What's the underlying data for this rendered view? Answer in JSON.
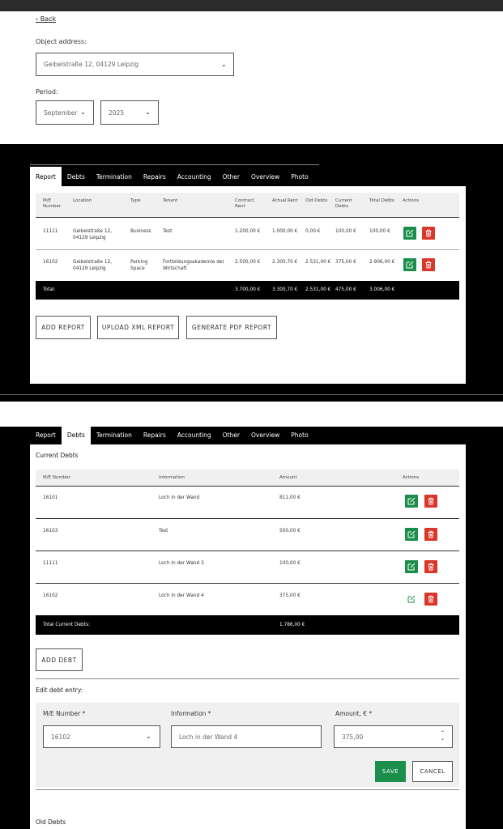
{
  "back": "Back",
  "object_address": {
    "label": "Object address:",
    "value": "Geibelstraße 12, 04129 Leipzig"
  },
  "period": {
    "label": "Period:",
    "month": "September",
    "year": "2025"
  },
  "tabs": [
    "Report",
    "Debts",
    "Termination",
    "Repairs",
    "Accounting",
    "Other",
    "Overview",
    "Photo"
  ],
  "report": {
    "headers": [
      "M/E Number",
      "Location",
      "Type",
      "Tenant",
      "Contract Rent",
      "Actual Rent",
      "Old Debts",
      "Current Debts",
      "Total Debts",
      "Actions"
    ],
    "rows": [
      {
        "me": "11111",
        "location": "Geibelstraße 12, 04129 Leipzig",
        "type": "Business",
        "tenant": "Test",
        "contract": "1.200,00 €",
        "actual": "1.000,00 €",
        "old": "0,00 €",
        "current": "100,00 €",
        "total": "100,00 €"
      },
      {
        "me": "16102",
        "location": "Geibelstraße 12, 04129 Leipzig",
        "type": "Parking Space",
        "tenant": "Fortbildungsakademie der Wirtschaft",
        "contract": "2.500,00 €",
        "actual": "2.300,70 €",
        "old": "2.531,00 €",
        "current": "375,00 €",
        "total": "2.906,00 €"
      }
    ],
    "total": {
      "label": "Total:",
      "contract": "3.700,00 €",
      "actual": "3.300,70 €",
      "old": "2.531,00 €",
      "current": "475,00 €",
      "total": "3.006,00 €"
    },
    "buttons": {
      "add": "ADD REPORT",
      "upload": "UPLOAD XML REPORT",
      "generate": "GENERATE PDF REPORT"
    }
  },
  "debts": {
    "section_title": "Current Debts",
    "headers": [
      "M/E Number",
      "Information",
      "Amount",
      "Actions"
    ],
    "rows": [
      {
        "me": "16101",
        "info": "Loch in der Wand",
        "amount": "811,00 €"
      },
      {
        "me": "16103",
        "info": "Test",
        "amount": "500,00 €"
      },
      {
        "me": "11111",
        "info": "Loch in der Wand 3",
        "amount": "100,00 €"
      },
      {
        "me": "16102",
        "info": "Loch in der Wand 4",
        "amount": "375,00 €"
      }
    ],
    "total": {
      "label": "Total Current Debts:",
      "amount": "1.786,00 €"
    },
    "add_button": "ADD DEBT",
    "edit": {
      "title": "Edit debt entry:",
      "me_label": "M/E Number *",
      "me_value": "16102",
      "info_label": "Information *",
      "info_value": "Loch in der Wand 4",
      "amount_label": "Amount, € *",
      "amount_value": "375,00",
      "save": "SAVE",
      "cancel": "CANCEL"
    },
    "old_debts_title": "Old Debts"
  },
  "colors": {
    "edit_green": "#1b8e4b",
    "delete_red": "#d9372a",
    "save_green": "#1b8e4b"
  }
}
